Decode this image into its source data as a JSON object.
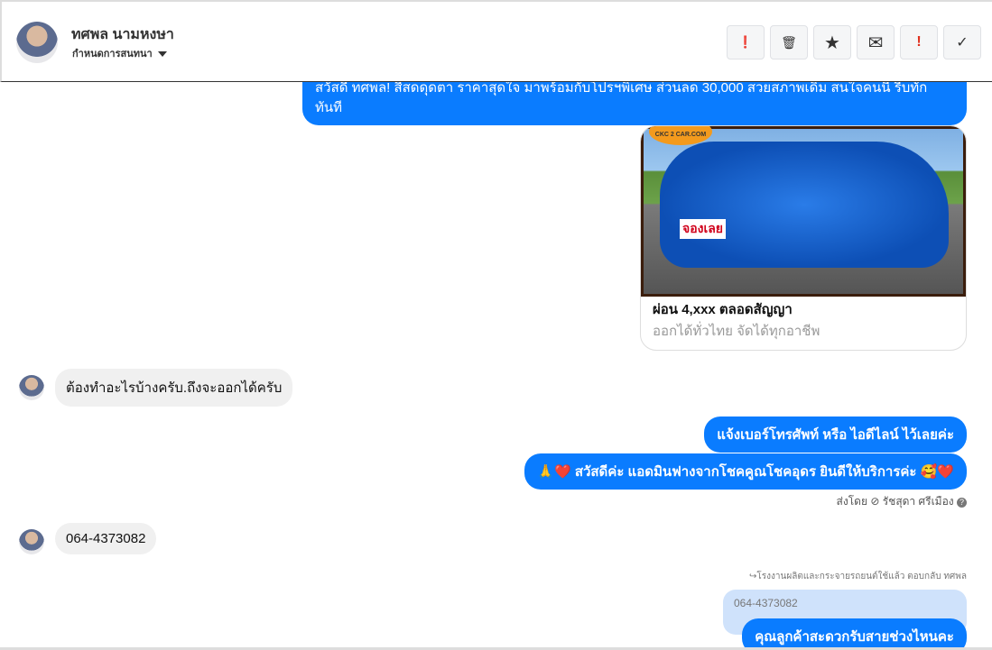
{
  "header": {
    "contact_name": "ทศพล นามหงษา",
    "assign_label": "กำหนดการสนทนา",
    "buttons": [
      {
        "icon": "alert-circle-icon",
        "glyph": "❗"
      },
      {
        "icon": "trash-icon",
        "glyph": "🗑"
      },
      {
        "icon": "star-icon",
        "glyph": "★"
      },
      {
        "icon": "envelope-icon",
        "glyph": "✉"
      },
      {
        "icon": "exclamation-icon",
        "glyph": "!"
      },
      {
        "icon": "check-icon",
        "glyph": "✓"
      }
    ]
  },
  "messages": {
    "promo": "สวัสดี ทศพล! สีสดดุดตา ราคาสุดใจ มาพร้อมกับโปรฯพิเศษ ส่วนลด 30,000 สวยสภาพเดิม สนใจคนนี้ รีบทัก ทันที",
    "card": {
      "logo": "CKC 2 CAR.COM",
      "tag": "จองเลย",
      "title": "ผ่อน 4,xxx ตลอดสัญญา",
      "subtitle": "ออกได้ทั่วไทย จัดได้ทุกอาชีพ"
    },
    "in1": "ต้องทำอะไรบ้างครับ.ถึงจะออกได้ครับ",
    "out1": "แจ้งเบอร์โทรศัพท์ หรือ ไอดีไลน์  ไว้เลยค่ะ",
    "out2": "🙏❤️ สวัสดีค่ะ แอดมินฟางจากโชคคูณโชคอุดร ยินดีให้บริการค่ะ  🥰❤️",
    "sent_by": "ส่งโดย ⊘ รัชสุดา ศรีเมือง",
    "in2": "064-4373082",
    "reply_label": "↪โรงงานผลิตและกระจายรถยนต์ใช้แล้ว ตอบกลับ ทศพล",
    "quoted": "064-4373082",
    "out3": "คุณลูกค้าสะดวกรับสายช่วงไหนคะ"
  }
}
